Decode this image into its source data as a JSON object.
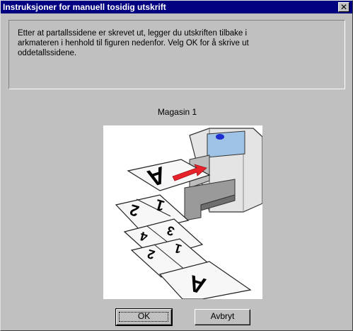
{
  "window": {
    "title": "Instruksjoner for manuell tosidig utskrift",
    "close_glyph": "✕"
  },
  "message": {
    "line1": "Etter at partallssidene er skrevet ut, legger du utskriften tilbake i",
    "line2": "arkmateren i henhold til figuren nedenfor. Velg OK for å skrive ut",
    "line3": "oddetallssidene."
  },
  "figure": {
    "tray_label": "Magasin 1",
    "icon": "printer-paper-illustration",
    "arrow_color": "#e8222a"
  },
  "buttons": {
    "ok_label": "OK",
    "cancel_label": "Avbryt"
  },
  "colors": {
    "titlebar": "#000080",
    "face": "#c0c0c0"
  }
}
